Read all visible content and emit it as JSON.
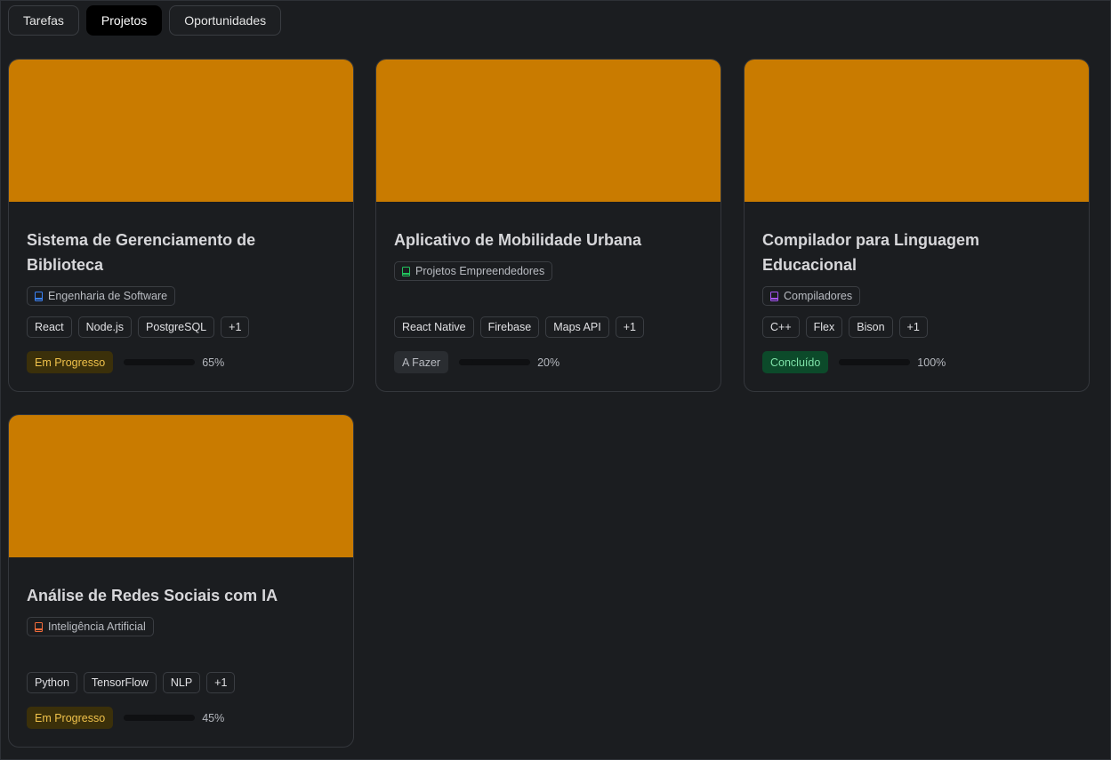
{
  "tabs": [
    {
      "label": "Tarefas",
      "active": false
    },
    {
      "label": "Projetos",
      "active": true
    },
    {
      "label": "Oportunidades",
      "active": false
    }
  ],
  "colors": {
    "cover": "#c97b00",
    "status_em_progresso_bg": "#3b300a",
    "status_em_progresso_fg": "#f0c24b",
    "status_a_fazer_bg": "#2a2d31",
    "status_a_fazer_fg": "#b9bcc2",
    "status_concluido_bg": "#0c4a2a",
    "status_concluido_fg": "#7ee2a8"
  },
  "projects": [
    {
      "title": "Sistema de Gerenciamento de Biblioteca",
      "subject": "Engenharia de Software",
      "subject_icon": "book-icon",
      "subject_icon_color": "#3b82f6",
      "tags": [
        "React",
        "Node.js",
        "PostgreSQL",
        "+1"
      ],
      "status": "Em Progresso",
      "status_key": "em_progresso",
      "progress": 65,
      "progress_label": "65%"
    },
    {
      "title": "Aplicativo de Mobilidade Urbana",
      "subject": "Projetos Empreendedores",
      "subject_icon": "book-icon",
      "subject_icon_color": "#22c55e",
      "tags": [
        "React Native",
        "Firebase",
        "Maps API",
        "+1"
      ],
      "status": "A Fazer",
      "status_key": "a_fazer",
      "progress": 20,
      "progress_label": "20%"
    },
    {
      "title": "Compilador para Linguagem Educacional",
      "subject": "Compiladores",
      "subject_icon": "book-icon",
      "subject_icon_color": "#a855f7",
      "tags": [
        "C++",
        "Flex",
        "Bison",
        "+1"
      ],
      "status": "Concluído",
      "status_key": "concluido",
      "progress": 100,
      "progress_label": "100%"
    },
    {
      "title": "Análise de Redes Sociais com IA",
      "subject": "Inteligência Artificial",
      "subject_icon": "book-icon",
      "subject_icon_color": "#f26b3a",
      "tags": [
        "Python",
        "TensorFlow",
        "NLP",
        "+1"
      ],
      "status": "Em Progresso",
      "status_key": "em_progresso",
      "progress": 45,
      "progress_label": "45%"
    }
  ]
}
